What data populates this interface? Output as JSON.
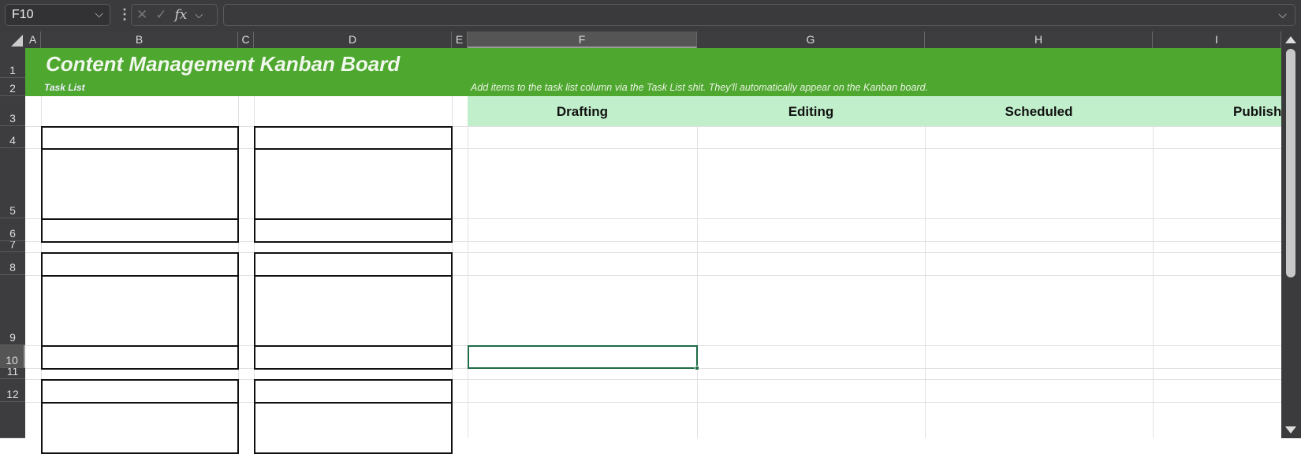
{
  "formula_bar": {
    "name_box": "F10",
    "fx_label": "fx",
    "cancel_icon": "✕",
    "enter_icon": "✓",
    "formula": ""
  },
  "columns": [
    "A",
    "B",
    "C",
    "D",
    "E",
    "F",
    "G",
    "H",
    "I"
  ],
  "rows": [
    "1",
    "2",
    "3",
    "4",
    "5",
    "6",
    "7",
    "8",
    "9",
    "10",
    "11",
    "12",
    ""
  ],
  "selected_cell": "F10",
  "sheet": {
    "title": "Content Management Kanban Board",
    "task_list_label": "Task List",
    "hint": "Add items to the task list column via the Task List shit. They'll automatically appear on the Kanban board.",
    "stages": [
      "Drafting",
      "Editing",
      "Scheduled",
      "Publish"
    ]
  },
  "colors": {
    "banner": "#4ea72e",
    "stage_header": "#c1efcb",
    "selection": "#1e6b45"
  }
}
